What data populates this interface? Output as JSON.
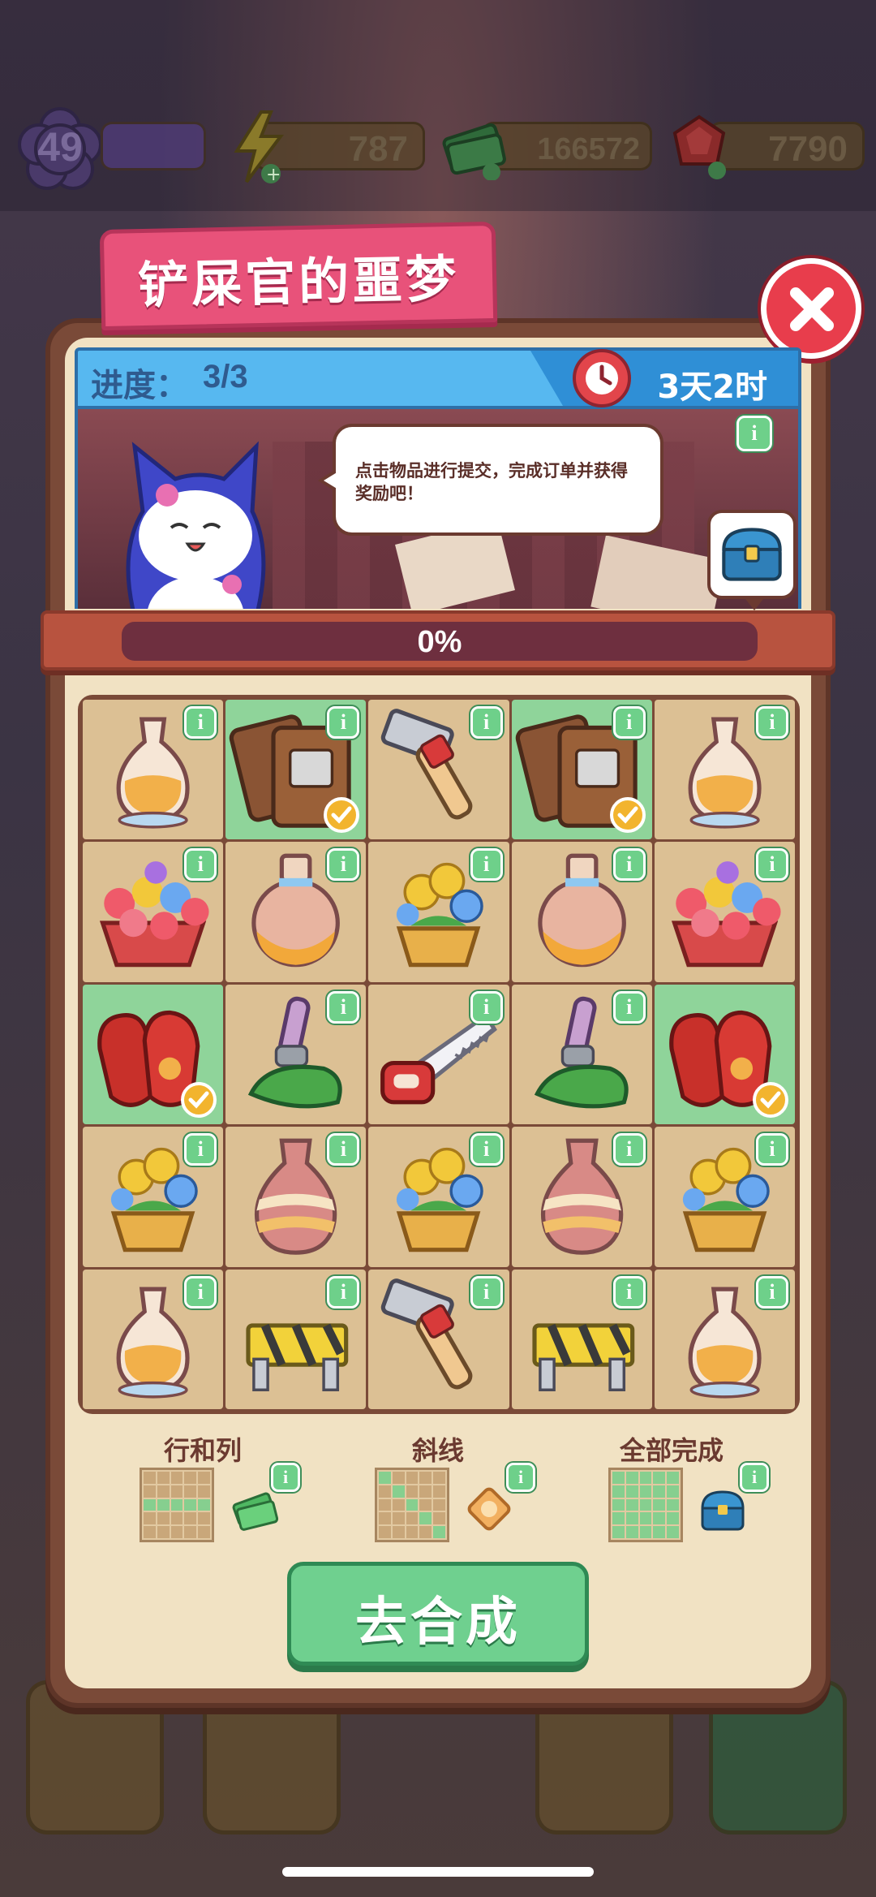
{
  "hud": {
    "level": "49",
    "energy": "787",
    "cash": "166572",
    "gems": "7790"
  },
  "popup": {
    "title": "铲屎官的噩梦",
    "progress_label": "进度：",
    "progress_value": "3/3",
    "timer": "3天2时",
    "speech": "点击物品进行提交，完成订单并获得奖励吧！",
    "bar_text": "0%",
    "bar_fraction": 0,
    "go_button": "去合成"
  },
  "grid": [
    [
      "vase-icon",
      "pouch-icon",
      "hammer-icon",
      "pouch-icon",
      "vase-icon"
    ],
    [
      "flower-basket-icon",
      "round-vase-icon",
      "flower-pot-icon",
      "round-vase-icon",
      "flower-basket-icon"
    ],
    [
      "gloves-icon",
      "brush-icon",
      "saw-icon",
      "brush-icon",
      "gloves-icon"
    ],
    [
      "flower-pot-icon",
      "striped-vase-icon",
      "flower-pot-icon",
      "striped-vase-icon",
      "flower-pot-icon"
    ],
    [
      "vase-icon",
      "barrier-icon",
      "hammer-icon",
      "barrier-icon",
      "vase-icon"
    ]
  ],
  "rewards": [
    {
      "label": "行和列",
      "icon": "cash-icon"
    },
    {
      "label": "斜线",
      "icon": "coin-icon"
    },
    {
      "label": "全部完成",
      "icon": "chest-icon"
    }
  ],
  "info_glyph": "i"
}
